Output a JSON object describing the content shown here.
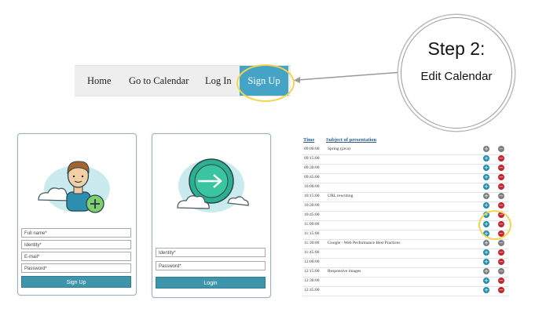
{
  "nav": {
    "items": [
      "Home",
      "Go to Calendar",
      "Log In"
    ],
    "signup_label": "Sign Up"
  },
  "step": {
    "title": "Step 2:",
    "subtitle": "Edit Calendar"
  },
  "signup_form": {
    "fields": [
      "Full name*",
      "Identity*",
      "E-mail*",
      "Password*"
    ],
    "button": "Sign Up"
  },
  "login_form": {
    "fields": [
      "Identity*",
      "Password*"
    ],
    "button": "Login"
  },
  "schedule": {
    "headers": [
      "Time",
      "Subject of presentation"
    ],
    "rows": [
      {
        "time": "09:00:00",
        "subject": "Spring (java)",
        "booked": true
      },
      {
        "time": "09:15:00",
        "subject": "",
        "booked": false
      },
      {
        "time": "09:30:00",
        "subject": "",
        "booked": false
      },
      {
        "time": "09:45:00",
        "subject": "",
        "booked": false
      },
      {
        "time": "10:00:00",
        "subject": "",
        "booked": false
      },
      {
        "time": "10:15:00",
        "subject": "URL rewriting",
        "booked": true
      },
      {
        "time": "10:30:00",
        "subject": "",
        "booked": false
      },
      {
        "time": "10:45:00",
        "subject": "",
        "booked": false
      },
      {
        "time": "11:00:00",
        "subject": "",
        "booked": false
      },
      {
        "time": "11:15:00",
        "subject": "",
        "booked": false
      },
      {
        "time": "11:30:00",
        "subject": "Google - Web Performance Best Practices",
        "booked": true
      },
      {
        "time": "11:45:00",
        "subject": "",
        "booked": false
      },
      {
        "time": "12:00:00",
        "subject": "",
        "booked": false
      },
      {
        "time": "12:15:00",
        "subject": "Responsive images",
        "booked": true
      },
      {
        "time": "12:30:00",
        "subject": "",
        "booked": false
      },
      {
        "time": "12:45:00",
        "subject": "",
        "booked": false
      }
    ]
  },
  "colors": {
    "accent": "#45a3c6",
    "highlight": "#f2d54a",
    "add": "#1f8fb0",
    "remove": "#c0262e",
    "disabled": "#7d7d7d"
  }
}
